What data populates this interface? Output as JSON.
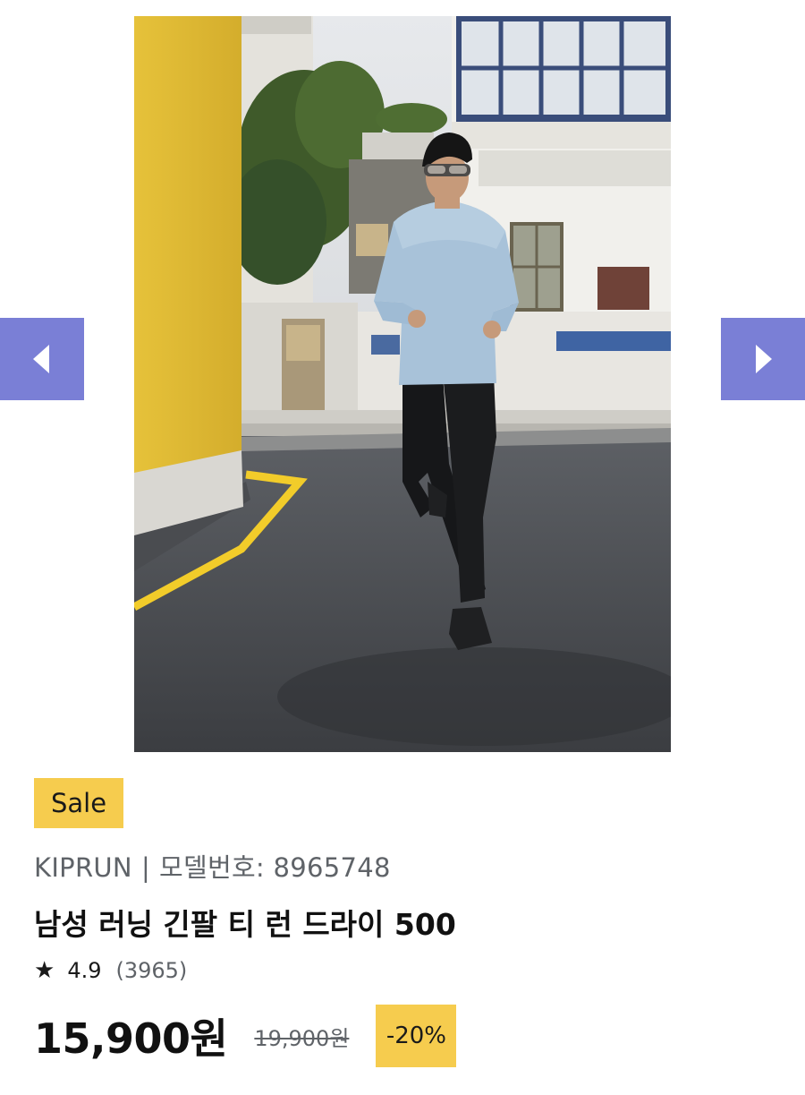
{
  "gallery": {
    "image_alt": "",
    "prev_icon": "chevron-left-icon",
    "next_icon": "chevron-right-icon",
    "nav_color": "#7a7fd6"
  },
  "product": {
    "badge": "Sale",
    "brand": "KIPRUN",
    "separator": "|",
    "model_label": "모델번호: 8965748",
    "title": "남성 러닝 긴팔 티 런 드라이 500",
    "rating": {
      "star_icon": "star-icon",
      "star": "★",
      "score": "4.9",
      "count": "(3965)"
    },
    "price": {
      "current": "15,900원",
      "original": "19,900원",
      "discount": "-20%"
    },
    "accent_color": "#f6cc4e"
  }
}
